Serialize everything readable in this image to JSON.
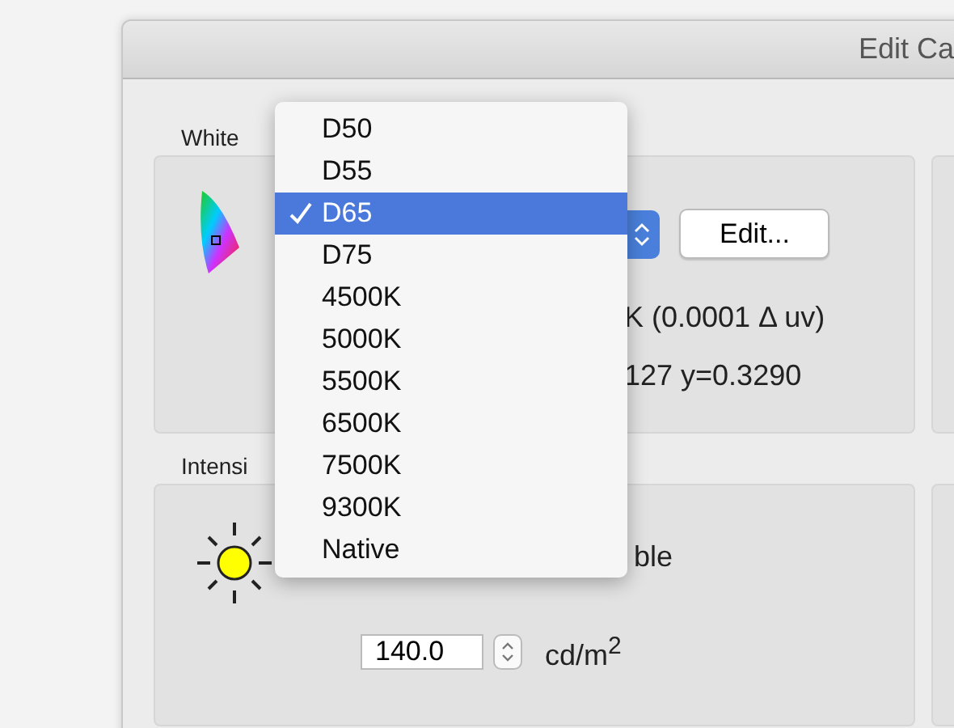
{
  "window": {
    "title": "Edit Ca"
  },
  "white_point": {
    "label": "White",
    "edit_button": "Edit...",
    "color_temp": "K (0.0001 Δ uv)",
    "cie_xy": "127 y=0.3290"
  },
  "intensity": {
    "label": "Intensi",
    "option": "ble",
    "value": "140.0",
    "unit": "cd/m$^{2}$"
  },
  "menu": {
    "items": [
      {
        "label": "D50",
        "selected": false
      },
      {
        "label": "D55",
        "selected": false
      },
      {
        "label": "D65",
        "selected": true
      },
      {
        "label": "D75",
        "selected": false
      },
      {
        "label": "4500K",
        "selected": false
      },
      {
        "label": "5000K",
        "selected": false
      },
      {
        "label": "5500K",
        "selected": false
      },
      {
        "label": "6500K",
        "selected": false
      },
      {
        "label": "7500K",
        "selected": false
      },
      {
        "label": "9300K",
        "selected": false
      },
      {
        "label": "Native",
        "selected": false
      }
    ]
  }
}
